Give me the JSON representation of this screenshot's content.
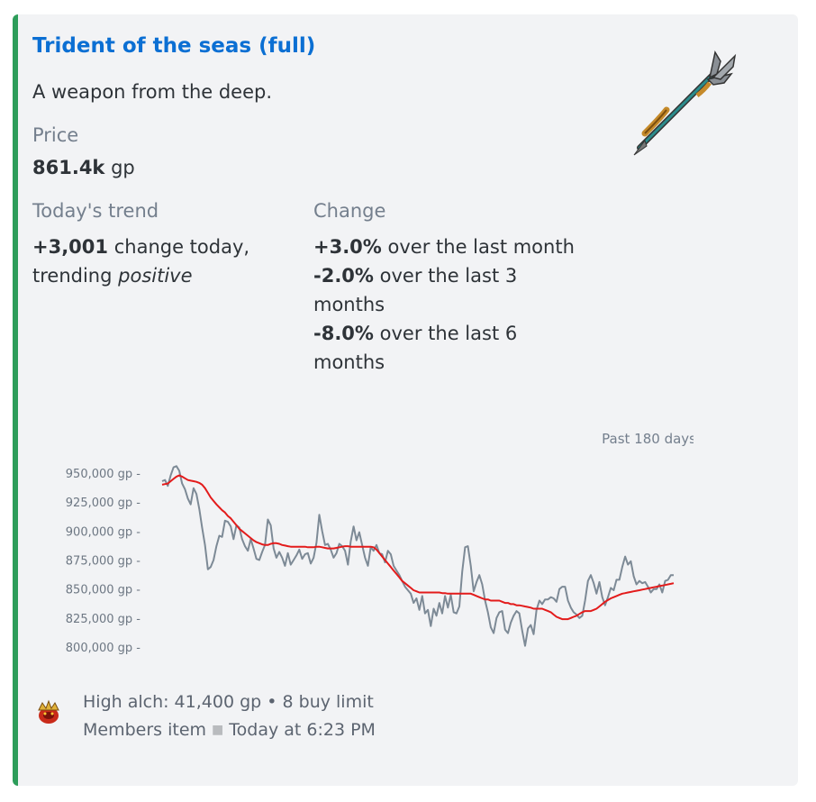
{
  "item": {
    "title": "Trident of the seas (full)",
    "description": "A weapon from the deep."
  },
  "price": {
    "label": "Price",
    "value": "861.4k",
    "unit": "gp"
  },
  "trend": {
    "label": "Today's trend",
    "change_value": "+3,001",
    "change_text": "change today,",
    "trending_text": "trending",
    "direction": "positive"
  },
  "change": {
    "label": "Change",
    "rows": [
      {
        "pct": "+3.0%",
        "text": "over the last month"
      },
      {
        "pct": "-2.0%",
        "text": "over the last 3 months"
      },
      {
        "pct": "-8.0%",
        "text": "over the last 6 months"
      }
    ]
  },
  "chart_data": {
    "type": "line",
    "title": "Past 180 days",
    "ylim": [
      800000,
      950000
    ],
    "ytick_labels": [
      "950,000 gp -",
      "925,000 gp -",
      "900,000 gp -",
      "875,000 gp -",
      "850,000 gp -",
      "825,000 gp -",
      "800,000 gp -"
    ],
    "yticks": [
      950000,
      925000,
      900000,
      875000,
      850000,
      825000,
      800000
    ],
    "x": [
      1,
      2,
      3,
      4,
      5,
      6,
      7,
      8,
      9,
      10,
      11,
      12,
      13,
      14,
      15,
      16,
      17,
      18,
      19,
      20,
      21,
      22,
      23,
      24,
      25,
      26,
      27,
      28,
      29,
      30,
      31,
      32,
      33,
      34,
      35,
      36,
      37,
      38,
      39,
      40,
      41,
      42,
      43,
      44,
      45,
      46,
      47,
      48,
      49,
      50,
      51,
      52,
      53,
      54,
      55,
      56,
      57,
      58,
      59,
      60,
      61,
      62,
      63,
      64,
      65,
      66,
      67,
      68,
      69,
      70,
      71,
      72,
      73,
      74,
      75,
      76,
      77,
      78,
      79,
      80,
      81,
      82,
      83,
      84,
      85,
      86,
      87,
      88,
      89,
      90,
      91,
      92,
      93,
      94,
      95,
      96,
      97,
      98,
      99,
      100,
      101,
      102,
      103,
      104,
      105,
      106,
      107,
      108,
      109,
      110,
      111,
      112,
      113,
      114,
      115,
      116,
      117,
      118,
      119,
      120,
      121,
      122,
      123,
      124,
      125,
      126,
      127,
      128,
      129,
      130,
      131,
      132,
      133,
      134,
      135,
      136,
      137,
      138,
      139,
      140,
      141,
      142,
      143,
      144,
      145,
      146,
      147,
      148,
      149,
      150,
      151,
      152,
      153,
      154,
      155,
      156,
      157,
      158,
      159,
      160,
      161,
      162,
      163,
      164,
      165,
      166,
      167,
      168,
      169,
      170,
      171,
      172,
      173,
      174,
      175,
      176,
      177,
      178,
      179,
      180
    ],
    "series": [
      {
        "color": "#7d8a96",
        "values": [
          943000,
          944000,
          939000,
          948000,
          955000,
          956000,
          952000,
          941000,
          936000,
          928000,
          923000,
          937000,
          932000,
          919000,
          903000,
          888000,
          867000,
          869000,
          875000,
          887000,
          896000,
          895000,
          909000,
          908000,
          904000,
          893000,
          905000,
          903000,
          893000,
          887000,
          883000,
          893000,
          885000,
          876000,
          875000,
          882000,
          888000,
          910000,
          905000,
          885000,
          877000,
          882000,
          877000,
          870000,
          881000,
          871000,
          875000,
          879000,
          884000,
          876000,
          880000,
          881000,
          872000,
          877000,
          890000,
          914000,
          900000,
          888000,
          889000,
          884000,
          877000,
          881000,
          889000,
          887000,
          883000,
          871000,
          891000,
          904000,
          892000,
          899000,
          888000,
          877000,
          870000,
          886000,
          883000,
          888000,
          881000,
          880000,
          873000,
          883000,
          880000,
          870000,
          866000,
          862000,
          857000,
          852000,
          849000,
          846000,
          838000,
          842000,
          832000,
          844000,
          829000,
          832000,
          818000,
          833000,
          827000,
          838000,
          829000,
          844000,
          834000,
          845000,
          830000,
          829000,
          835000,
          865000,
          886000,
          887000,
          870000,
          848000,
          856000,
          862000,
          854000,
          840000,
          830000,
          817000,
          812000,
          825000,
          830000,
          831000,
          815000,
          812000,
          821000,
          827000,
          831000,
          829000,
          814000,
          801000,
          816000,
          819000,
          811000,
          832000,
          840000,
          837000,
          841000,
          841000,
          843000,
          842000,
          839000,
          850000,
          852000,
          852000,
          840000,
          834000,
          830000,
          828000,
          825000,
          827000,
          840000,
          857000,
          862000,
          855000,
          846000,
          856000,
          843000,
          836000,
          843000,
          851000,
          849000,
          858000,
          858000,
          869000,
          878000,
          871000,
          874000,
          861000,
          854000,
          857000,
          855000,
          856000,
          852000,
          847000,
          850000,
          850000,
          854000,
          847000,
          857000,
          858000,
          862000,
          862000
        ]
      },
      {
        "color": "#e31b1b",
        "values": [
          940000,
          940500,
          941000,
          943000,
          945000,
          947000,
          948000,
          947000,
          945500,
          944000,
          943500,
          943000,
          942500,
          941500,
          940000,
          937000,
          933000,
          929000,
          926000,
          923000,
          920500,
          918000,
          916000,
          913000,
          911000,
          908000,
          905000,
          902000,
          900000,
          898000,
          896000,
          894000,
          892000,
          890500,
          889500,
          888500,
          888000,
          888000,
          889000,
          889500,
          889500,
          889000,
          888000,
          887500,
          887000,
          886500,
          886500,
          886500,
          886500,
          886500,
          886500,
          886000,
          886000,
          886000,
          886500,
          886500,
          886000,
          885500,
          885000,
          885000,
          885000,
          885500,
          886000,
          886500,
          887000,
          887000,
          886500,
          886500,
          886500,
          886500,
          886500,
          886500,
          886500,
          886500,
          886000,
          884000,
          881000,
          878000,
          875000,
          872000,
          869000,
          866000,
          863000,
          860000,
          857000,
          855000,
          853000,
          851000,
          849000,
          848000,
          847000,
          847000,
          847000,
          847000,
          847000,
          847000,
          847000,
          847000,
          846500,
          846500,
          846000,
          846000,
          846000,
          846000,
          846000,
          846000,
          846000,
          846000,
          846000,
          845000,
          844000,
          843000,
          842000,
          841000,
          841000,
          840000,
          840000,
          840000,
          840000,
          839000,
          838000,
          838000,
          837000,
          837000,
          836000,
          836000,
          835500,
          835000,
          834500,
          834000,
          833000,
          833000,
          833000,
          833000,
          832000,
          831000,
          830000,
          828000,
          826000,
          825000,
          824000,
          824000,
          824000,
          825000,
          826000,
          827000,
          828500,
          830000,
          831000,
          831000,
          831000,
          832000,
          833000,
          835000,
          837000,
          839000,
          840500,
          842000,
          843000,
          844000,
          845000,
          846000,
          846500,
          847000,
          847500,
          848000,
          848500,
          849000,
          849500,
          850000,
          850500,
          851000,
          851500,
          852000,
          852500,
          853000,
          853500,
          854000,
          854500,
          855000
        ]
      }
    ]
  },
  "footer": {
    "high_alch": "High alch: 41,400 gp",
    "bullet": "•",
    "buy_limit": "8 buy limit",
    "members": "Members item",
    "timestamp": "Today at 6:23 PM"
  },
  "colors": {
    "accent_bar": "#2d9d5a",
    "title_link": "#0b6fd3",
    "price_line": "#7d8a96",
    "average_line": "#e31b1b"
  },
  "icons": {
    "thumbnail": "trident-icon",
    "footer": "members-icon"
  }
}
